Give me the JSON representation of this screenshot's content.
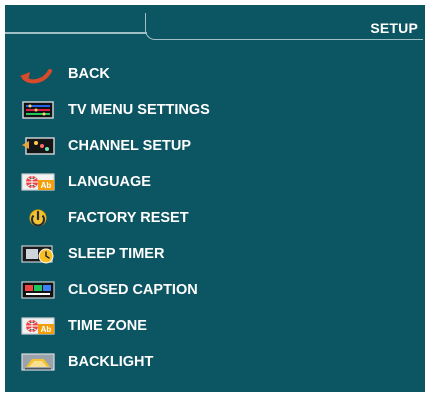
{
  "app": {
    "colors": {
      "panel": "#0c5562",
      "header_stroke": "#9fc0c5",
      "text": "#ffffff",
      "accent_red": "#d94a2b"
    }
  },
  "header": {
    "title": "SETUP"
  },
  "menu": {
    "items": [
      {
        "label": "BACK",
        "icon": "back-arrow-icon"
      },
      {
        "label": "TV MENU SETTINGS",
        "icon": "tv-menu-settings-icon"
      },
      {
        "label": "CHANNEL SETUP",
        "icon": "channel-setup-icon"
      },
      {
        "label": "LANGUAGE",
        "icon": "language-icon"
      },
      {
        "label": "FACTORY RESET",
        "icon": "factory-reset-icon"
      },
      {
        "label": "SLEEP TIMER",
        "icon": "sleep-timer-icon"
      },
      {
        "label": "CLOSED CAPTION",
        "icon": "closed-caption-icon"
      },
      {
        "label": "TIME ZONE",
        "icon": "time-zone-icon"
      },
      {
        "label": "BACKLIGHT",
        "icon": "backlight-icon"
      }
    ]
  }
}
